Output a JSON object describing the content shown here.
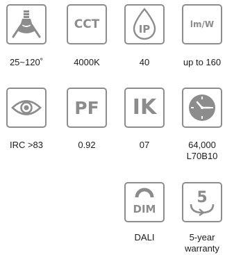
{
  "colors": {
    "icon_gray": "#8c8c8c",
    "text": "#1a1a1a",
    "background": "#ffffff"
  },
  "specs": [
    {
      "icon": "beam-angle-lamp-icon",
      "value": "25~120˚"
    },
    {
      "icon": "cct-icon",
      "icon_text": "CCT",
      "value": "4000K"
    },
    {
      "icon": "ip-rating-drop-icon",
      "icon_text": "IP",
      "value": "40"
    },
    {
      "icon": "efficacy-icon",
      "icon_text": "lm/W",
      "value": "up to 160"
    },
    {
      "icon": "eye-cri-icon",
      "value": "IRC >83"
    },
    {
      "icon": "power-factor-icon",
      "icon_text": "PF",
      "value": "0.92"
    },
    {
      "icon": "impact-rating-icon",
      "icon_text": "IK",
      "value": "07"
    },
    {
      "icon": "clock-lifetime-icon",
      "value_line1": "64,000",
      "value_line2": "L70B10"
    },
    {
      "icon": "dimming-icon",
      "icon_text": "DIM",
      "value": "DALI"
    },
    {
      "icon": "warranty-icon",
      "icon_text": "5",
      "value_line1": "5-year",
      "value_line2": "warranty"
    }
  ]
}
